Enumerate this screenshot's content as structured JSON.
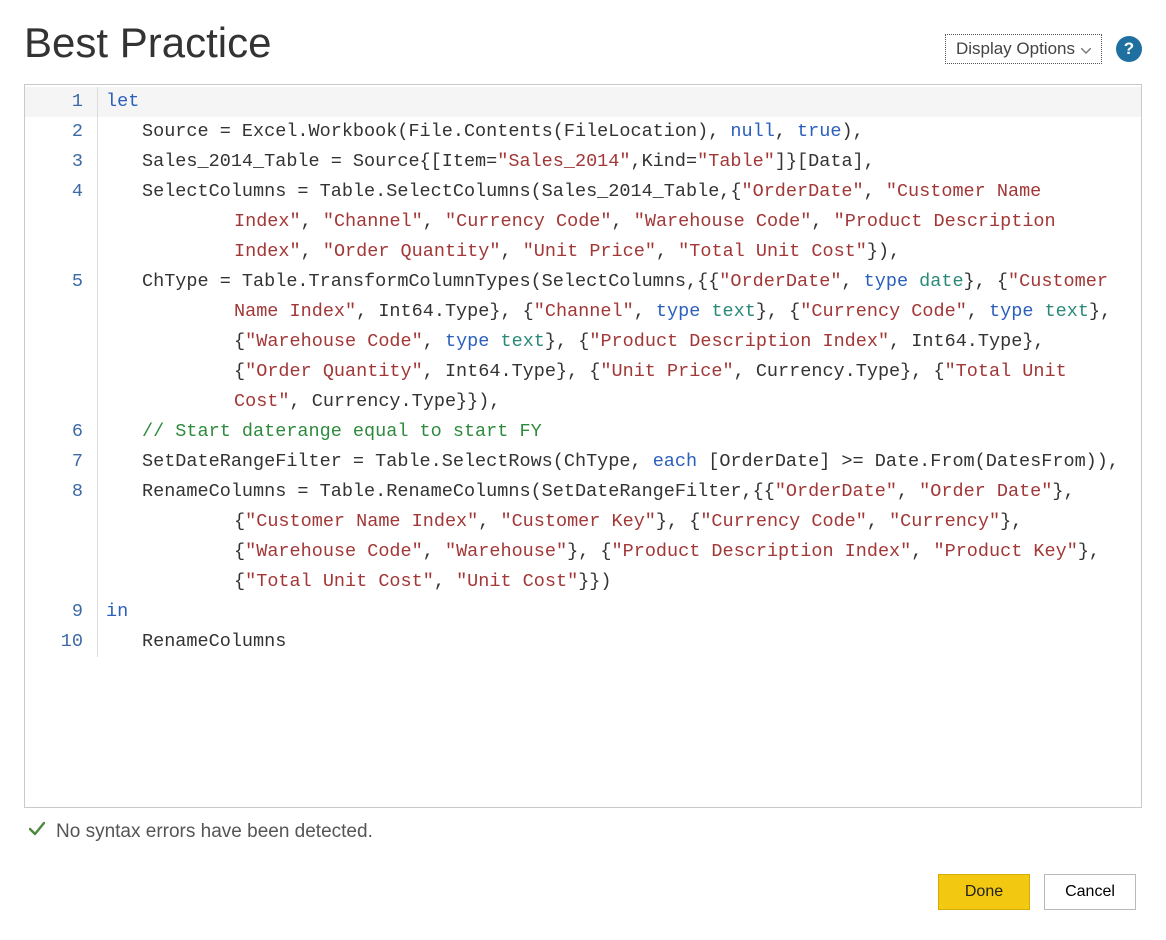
{
  "title": "Best Practice",
  "header": {
    "display_options_label": "Display Options",
    "help_glyph": "?"
  },
  "status": {
    "message": "No syntax errors have been detected."
  },
  "buttons": {
    "done": "Done",
    "cancel": "Cancel"
  },
  "code": {
    "line_count": 10,
    "lines": [
      {
        "n": 1,
        "indent": 0,
        "tokens": [
          {
            "t": "let",
            "c": "kw"
          }
        ]
      },
      {
        "n": 2,
        "indent": 1,
        "tokens": [
          {
            "t": "Source = Excel.Workbook(File.Contents(FileLocation), ",
            "c": "plain"
          },
          {
            "t": "null",
            "c": "kw"
          },
          {
            "t": ", ",
            "c": "plain"
          },
          {
            "t": "true",
            "c": "kw"
          },
          {
            "t": "),",
            "c": "plain"
          }
        ]
      },
      {
        "n": 3,
        "indent": 1,
        "tokens": [
          {
            "t": "Sales_2014_Table = Source{[Item=",
            "c": "plain"
          },
          {
            "t": "\"Sales_2014\"",
            "c": "str"
          },
          {
            "t": ",Kind=",
            "c": "plain"
          },
          {
            "t": "\"Table\"",
            "c": "str"
          },
          {
            "t": "]}[Data],",
            "c": "plain"
          }
        ]
      },
      {
        "n": 4,
        "indent": 1,
        "tokens": [
          {
            "t": "SelectColumns = Table.SelectColumns(Sales_2014_Table,{",
            "c": "plain"
          },
          {
            "t": "\"OrderDate\"",
            "c": "str"
          },
          {
            "t": ", ",
            "c": "plain"
          },
          {
            "t": "\"Customer Name Index\"",
            "c": "str"
          },
          {
            "t": ", ",
            "c": "plain"
          },
          {
            "t": "\"Channel\"",
            "c": "str"
          },
          {
            "t": ", ",
            "c": "plain"
          },
          {
            "t": "\"Currency Code\"",
            "c": "str"
          },
          {
            "t": ", ",
            "c": "plain"
          },
          {
            "t": "\"Warehouse Code\"",
            "c": "str"
          },
          {
            "t": ", ",
            "c": "plain"
          },
          {
            "t": "\"Product Description Index\"",
            "c": "str"
          },
          {
            "t": ", ",
            "c": "plain"
          },
          {
            "t": "\"Order Quantity\"",
            "c": "str"
          },
          {
            "t": ", ",
            "c": "plain"
          },
          {
            "t": "\"Unit Price\"",
            "c": "str"
          },
          {
            "t": ", ",
            "c": "plain"
          },
          {
            "t": "\"Total Unit Cost\"",
            "c": "str"
          },
          {
            "t": "}),",
            "c": "plain"
          }
        ]
      },
      {
        "n": 5,
        "indent": 1,
        "tokens": [
          {
            "t": "ChType = Table.TransformColumnTypes(SelectColumns,{{",
            "c": "plain"
          },
          {
            "t": "\"OrderDate\"",
            "c": "str"
          },
          {
            "t": ", ",
            "c": "plain"
          },
          {
            "t": "type",
            "c": "kw"
          },
          {
            "t": " ",
            "c": "plain"
          },
          {
            "t": "date",
            "c": "tkw"
          },
          {
            "t": "}, {",
            "c": "plain"
          },
          {
            "t": "\"Customer Name Index\"",
            "c": "str"
          },
          {
            "t": ", Int64.Type}, {",
            "c": "plain"
          },
          {
            "t": "\"Channel\"",
            "c": "str"
          },
          {
            "t": ", ",
            "c": "plain"
          },
          {
            "t": "type",
            "c": "kw"
          },
          {
            "t": " ",
            "c": "plain"
          },
          {
            "t": "text",
            "c": "tkw"
          },
          {
            "t": "}, {",
            "c": "plain"
          },
          {
            "t": "\"Currency Code\"",
            "c": "str"
          },
          {
            "t": ", ",
            "c": "plain"
          },
          {
            "t": "type",
            "c": "kw"
          },
          {
            "t": " ",
            "c": "plain"
          },
          {
            "t": "text",
            "c": "tkw"
          },
          {
            "t": "}, {",
            "c": "plain"
          },
          {
            "t": "\"Warehouse Code\"",
            "c": "str"
          },
          {
            "t": ", ",
            "c": "plain"
          },
          {
            "t": "type",
            "c": "kw"
          },
          {
            "t": " ",
            "c": "plain"
          },
          {
            "t": "text",
            "c": "tkw"
          },
          {
            "t": "}, {",
            "c": "plain"
          },
          {
            "t": "\"Product Description Index\"",
            "c": "str"
          },
          {
            "t": ", Int64.Type}, {",
            "c": "plain"
          },
          {
            "t": "\"Order Quantity\"",
            "c": "str"
          },
          {
            "t": ", Int64.Type}, {",
            "c": "plain"
          },
          {
            "t": "\"Unit Price\"",
            "c": "str"
          },
          {
            "t": ", Currency.Type}, {",
            "c": "plain"
          },
          {
            "t": "\"Total Unit Cost\"",
            "c": "str"
          },
          {
            "t": ", Currency.Type}}),",
            "c": "plain"
          }
        ]
      },
      {
        "n": 6,
        "indent": 1,
        "tokens": [
          {
            "t": "// Start daterange equal to start FY",
            "c": "cmt"
          }
        ]
      },
      {
        "n": 7,
        "indent": 1,
        "tokens": [
          {
            "t": "SetDateRangeFilter = Table.SelectRows(ChType, ",
            "c": "plain"
          },
          {
            "t": "each",
            "c": "kw"
          },
          {
            "t": " [OrderDate] >= Date.From(DatesFrom)),",
            "c": "plain"
          }
        ]
      },
      {
        "n": 8,
        "indent": 1,
        "tokens": [
          {
            "t": "RenameColumns = Table.RenameColumns(SetDateRangeFilter,{{",
            "c": "plain"
          },
          {
            "t": "\"OrderDate\"",
            "c": "str"
          },
          {
            "t": ", ",
            "c": "plain"
          },
          {
            "t": "\"Order Date\"",
            "c": "str"
          },
          {
            "t": "}, {",
            "c": "plain"
          },
          {
            "t": "\"Customer Name Index\"",
            "c": "str"
          },
          {
            "t": ", ",
            "c": "plain"
          },
          {
            "t": "\"Customer Key\"",
            "c": "str"
          },
          {
            "t": "}, {",
            "c": "plain"
          },
          {
            "t": "\"Currency Code\"",
            "c": "str"
          },
          {
            "t": ", ",
            "c": "plain"
          },
          {
            "t": "\"Currency\"",
            "c": "str"
          },
          {
            "t": "}, {",
            "c": "plain"
          },
          {
            "t": "\"Warehouse Code\"",
            "c": "str"
          },
          {
            "t": ", ",
            "c": "plain"
          },
          {
            "t": "\"Warehouse\"",
            "c": "str"
          },
          {
            "t": "}, {",
            "c": "plain"
          },
          {
            "t": "\"Product Description Index\"",
            "c": "str"
          },
          {
            "t": ", ",
            "c": "plain"
          },
          {
            "t": "\"Product Key\"",
            "c": "str"
          },
          {
            "t": "}, {",
            "c": "plain"
          },
          {
            "t": "\"Total Unit Cost\"",
            "c": "str"
          },
          {
            "t": ", ",
            "c": "plain"
          },
          {
            "t": "\"Unit Cost\"",
            "c": "str"
          },
          {
            "t": "}})",
            "c": "plain"
          }
        ]
      },
      {
        "n": 9,
        "indent": 0,
        "tokens": [
          {
            "t": "in",
            "c": "kw"
          }
        ]
      },
      {
        "n": 10,
        "indent": 1,
        "tokens": [
          {
            "t": "RenameColumns",
            "c": "plain"
          }
        ]
      }
    ]
  }
}
